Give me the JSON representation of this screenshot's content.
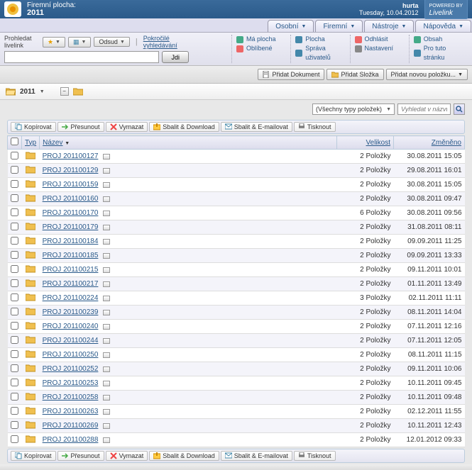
{
  "header": {
    "area_label": "Firemní plocha:",
    "area_name": "2011",
    "user": "hurta",
    "date": "Tuesday, 10.04.2012",
    "brand": "Livelink"
  },
  "tabs": [
    "Osobní",
    "Firemní",
    "Nástroje",
    "Nápověda"
  ],
  "search": {
    "label": "Prohledat livelink",
    "from_btn": "Odsud",
    "advanced": "Pokročilé vyhledávání",
    "go": "Jdi"
  },
  "menus": {
    "col1": [
      {
        "icon": "home",
        "label": "Má plocha"
      },
      {
        "icon": "heart",
        "label": "Oblíbené"
      }
    ],
    "col2": [
      {
        "icon": "grid",
        "label": "Plocha"
      },
      {
        "icon": "users",
        "label": "Správa uživatelů"
      }
    ],
    "col3": [
      {
        "icon": "logout",
        "label": "Odhlásit"
      },
      {
        "icon": "gear",
        "label": "Nastavení"
      }
    ],
    "col4": [
      {
        "icon": "book",
        "label": "Obsah"
      },
      {
        "icon": "help",
        "label": "Pro tuto stránku"
      }
    ]
  },
  "actions": {
    "add_doc": "Přidat Dokument",
    "add_folder": "Přidat Složka",
    "add_new": "Přidat novou položku..."
  },
  "crumb": {
    "name": "2011"
  },
  "filter": {
    "types": "(Všechny typy položek)",
    "placeholder": "Vyhledat v názvu"
  },
  "toolbar": {
    "copy": "Kopírovat",
    "move": "Přesunout",
    "delete": "Vymazat",
    "zip": "Sbalit & Download",
    "mail": "Sbalit & E-mailovat",
    "print": "Tisknout"
  },
  "columns": {
    "type": "Typ",
    "name": "Název",
    "size": "Velikost",
    "modified": "Změněno"
  },
  "rows": [
    {
      "name": "PROJ 201100127",
      "size": "2 Položky",
      "mod": "30.08.2011 15:05"
    },
    {
      "name": "PROJ 201100129",
      "size": "2 Položky",
      "mod": "29.08.2011 16:01"
    },
    {
      "name": "PROJ 201100159",
      "size": "2 Položky",
      "mod": "30.08.2011 15:05"
    },
    {
      "name": "PROJ 201100160",
      "size": "2 Položky",
      "mod": "30.08.2011 09:47"
    },
    {
      "name": "PROJ 201100170",
      "size": "6 Položky",
      "mod": "30.08.2011 09:56"
    },
    {
      "name": "PROJ 201100179",
      "size": "2 Položky",
      "mod": "31.08.2011 08:11"
    },
    {
      "name": "PROJ 201100184",
      "size": "2 Položky",
      "mod": "09.09.2011 11:25"
    },
    {
      "name": "PROJ 201100185",
      "size": "2 Položky",
      "mod": "09.09.2011 13:33"
    },
    {
      "name": "PROJ 201100215",
      "size": "2 Položky",
      "mod": "09.11.2011 10:01"
    },
    {
      "name": "PROJ 201100217",
      "size": "2 Položky",
      "mod": "01.11.2011 13:49"
    },
    {
      "name": "PROJ 201100224",
      "size": "3 Položky",
      "mod": "02.11.2011 11:11"
    },
    {
      "name": "PROJ 201100239",
      "size": "2 Položky",
      "mod": "08.11.2011 14:04"
    },
    {
      "name": "PROJ 201100240",
      "size": "2 Položky",
      "mod": "07.11.2011 12:16"
    },
    {
      "name": "PROJ 201100244",
      "size": "2 Položky",
      "mod": "07.11.2011 12:05"
    },
    {
      "name": "PROJ 201100250",
      "size": "2 Položky",
      "mod": "08.11.2011 11:15"
    },
    {
      "name": "PROJ 201100252",
      "size": "2 Položky",
      "mod": "09.11.2011 10:06"
    },
    {
      "name": "PROJ 201100253",
      "size": "2 Položky",
      "mod": "10.11.2011 09:45"
    },
    {
      "name": "PROJ 201100258",
      "size": "2 Položky",
      "mod": "10.11.2011 09:48"
    },
    {
      "name": "PROJ 201100263",
      "size": "2 Položky",
      "mod": "02.12.2011 11:55"
    },
    {
      "name": "PROJ 201100269",
      "size": "2 Položky",
      "mod": "10.11.2011 12:43"
    },
    {
      "name": "PROJ 201100288",
      "size": "2 Položky",
      "mod": "12.01.2012 09:33"
    }
  ]
}
